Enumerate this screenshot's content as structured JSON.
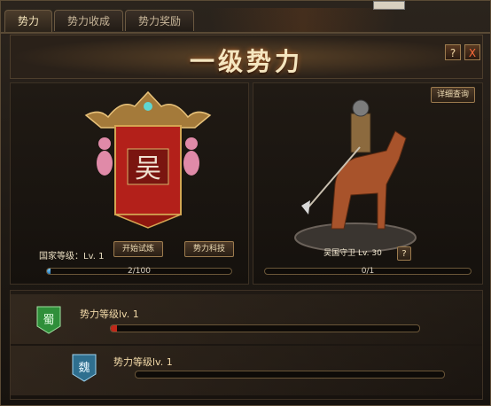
{
  "tabs": [
    "势力",
    "势力收成",
    "势力奖励"
  ],
  "header": {
    "title": "一级势力",
    "help_label": "?",
    "close_label": "X"
  },
  "left": {
    "banner_char": "吴",
    "country_level_label": "国家等级：Lv. 1",
    "challenge_button": "开始试炼",
    "tech_button": "势力科技",
    "progress_text": "2/100",
    "progress_value": 2,
    "progress_max": 100
  },
  "right": {
    "detail_button": "详细查询",
    "guard_label": "吴国守卫 Lv. 30",
    "help_label": "?",
    "progress_text": "0/1",
    "progress_value": 0,
    "progress_max": 1
  },
  "rows": [
    {
      "emblem_char": "蜀",
      "emblem_color": "#2f8f3a",
      "label": "势力等级lv. 1",
      "progress": 0.02
    },
    {
      "emblem_char": "魏",
      "emblem_color": "#2f6f8f",
      "label": "势力等级lv. 1",
      "progress": 0.0
    }
  ],
  "colors": {
    "accent": "#f2d9a8",
    "banner_red": "#b3201a",
    "bar_blue": "#4aa6e8",
    "bar_red": "#c0281a"
  },
  "icons": {
    "help": "question-icon",
    "close": "close-icon"
  }
}
